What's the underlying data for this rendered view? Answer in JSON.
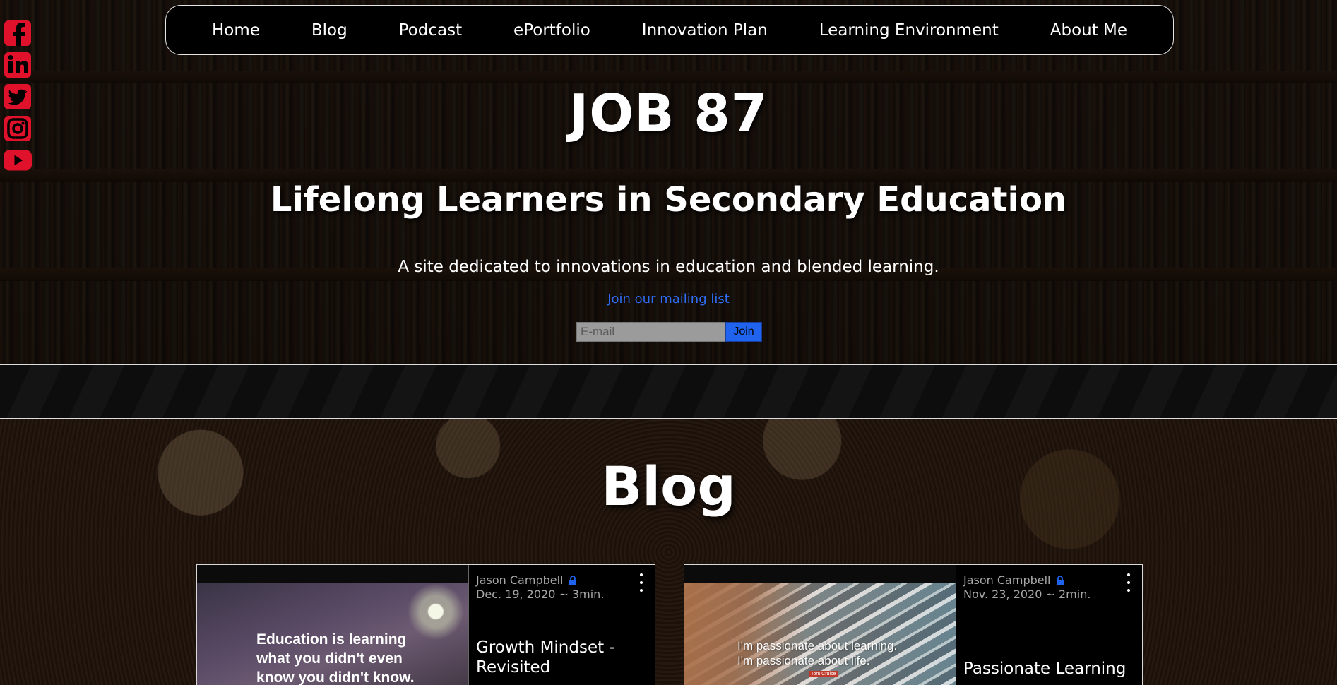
{
  "nav": {
    "items": [
      {
        "label": "Home"
      },
      {
        "label": "Blog"
      },
      {
        "label": "Podcast"
      },
      {
        "label": "ePortfolio"
      },
      {
        "label": "Innovation Plan"
      },
      {
        "label": "Learning Environment"
      },
      {
        "label": "About Me"
      }
    ]
  },
  "social": {
    "icons": [
      "facebook-icon",
      "linkedin-icon",
      "twitter-icon",
      "instagram-icon",
      "youtube-icon"
    ],
    "color": "#e0112b"
  },
  "hero": {
    "title": "JOB 87",
    "subtitle": "Lifelong Learners in Secondary Education",
    "tagline": "A site dedicated to innovations in education and blended learning.",
    "mailing_link": "Join our mailing list",
    "email_placeholder": "E-mail",
    "join_label": "Join"
  },
  "blog": {
    "heading": "Blog",
    "posts": [
      {
        "author": "Jason Campbell",
        "date": "Dec. 19, 2020 ~ 3min.",
        "title": "Growth Mindset - Revisited",
        "image_text": "Education is learning what you didn't even know you didn't know."
      },
      {
        "author": "Jason Campbell",
        "date": "Nov. 23, 2020 ~ 2min.",
        "title": "Passionate Learning",
        "image_text": "I'm passionate about learning. I'm passionate about life.",
        "image_credit": "Tom Cruise"
      }
    ]
  },
  "colors": {
    "accent_blue": "#1f63ef",
    "link_blue": "#2e6cf2",
    "social_red": "#e0112b"
  }
}
